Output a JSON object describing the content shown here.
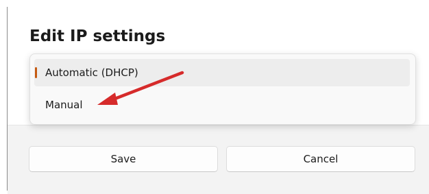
{
  "dialog": {
    "title": "Edit IP settings"
  },
  "dropdown": {
    "options": [
      {
        "label": "Automatic (DHCP)",
        "selected": true
      },
      {
        "label": "Manual",
        "selected": false
      }
    ]
  },
  "buttons": {
    "save_label": "Save",
    "cancel_label": "Cancel"
  },
  "colors": {
    "accent": "#c55a11",
    "annotation_arrow": "#d62b2b"
  }
}
